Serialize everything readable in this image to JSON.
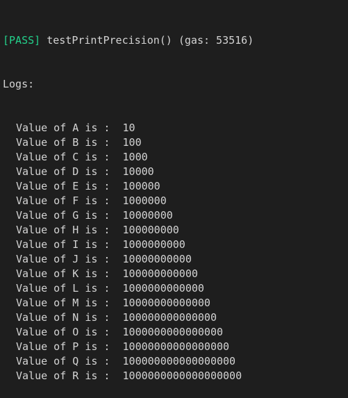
{
  "terminal": {
    "colors": {
      "background": "#1e1e1e",
      "text": "#d4d4d4",
      "pass": "#23d18b"
    },
    "result": {
      "status": "[PASS]",
      "test_name": "testPrintPrecision()",
      "gas": "(gas: 53516)"
    },
    "logs_label": "Logs:",
    "log_lines": [
      {
        "label": "Value of A is : ",
        "value": "10"
      },
      {
        "label": "Value of B is : ",
        "value": "100"
      },
      {
        "label": "Value of C is : ",
        "value": "1000"
      },
      {
        "label": "Value of D is : ",
        "value": "10000"
      },
      {
        "label": "Value of E is : ",
        "value": "100000"
      },
      {
        "label": "Value of F is : ",
        "value": "1000000"
      },
      {
        "label": "Value of G is : ",
        "value": "10000000"
      },
      {
        "label": "Value of H is : ",
        "value": "100000000"
      },
      {
        "label": "Value of I is : ",
        "value": "1000000000"
      },
      {
        "label": "Value of J is : ",
        "value": "10000000000"
      },
      {
        "label": "Value of K is : ",
        "value": "100000000000"
      },
      {
        "label": "Value of L is : ",
        "value": "1000000000000"
      },
      {
        "label": "Value of M is : ",
        "value": "10000000000000"
      },
      {
        "label": "Value of N is : ",
        "value": "100000000000000"
      },
      {
        "label": "Value of O is : ",
        "value": "1000000000000000"
      },
      {
        "label": "Value of P is : ",
        "value": "10000000000000000"
      },
      {
        "label": "Value of Q is : ",
        "value": "100000000000000000"
      },
      {
        "label": "Value of R is : ",
        "value": "1000000000000000000"
      }
    ]
  }
}
